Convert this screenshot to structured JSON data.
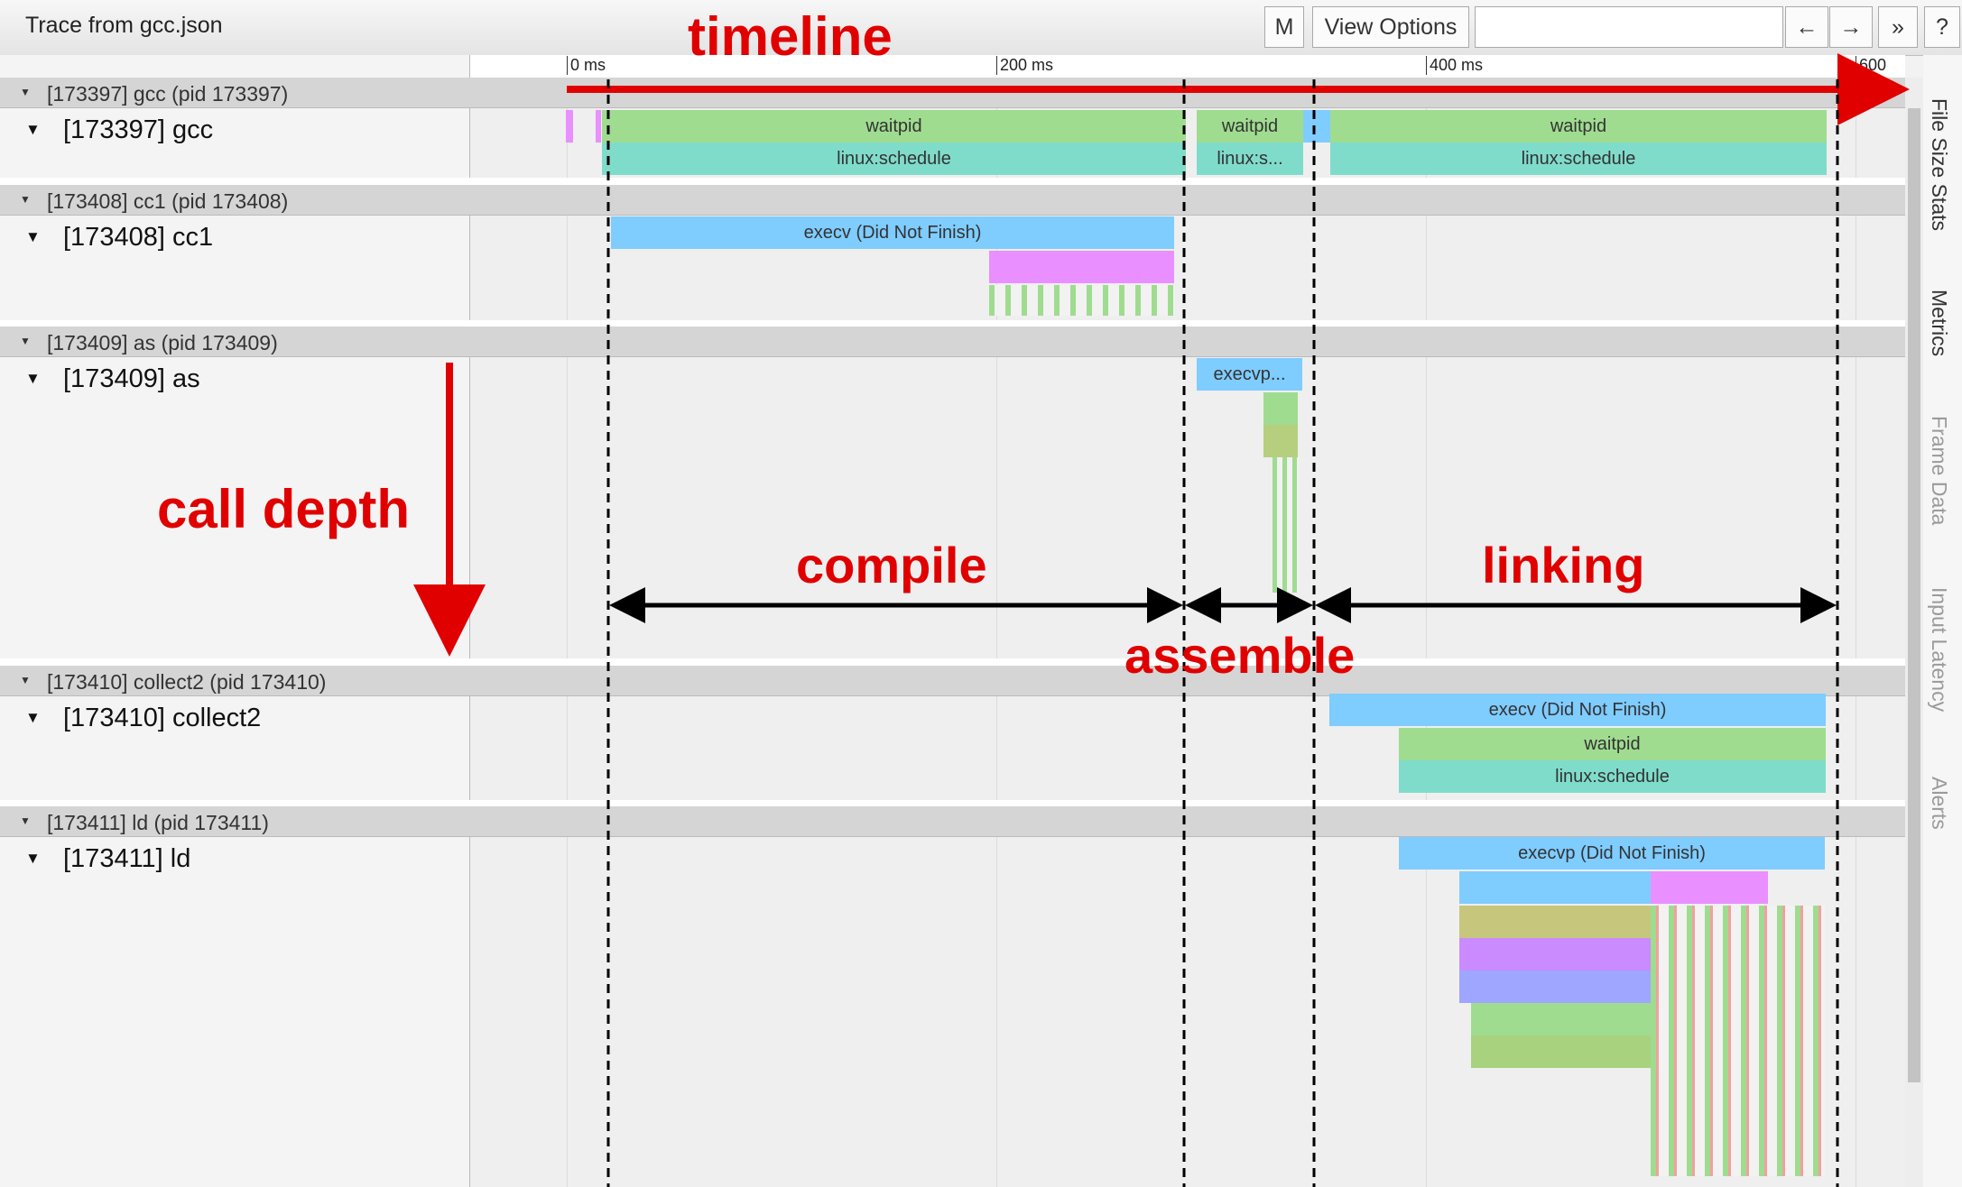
{
  "window": {
    "title": "Trace from gcc.json"
  },
  "toolbar": {
    "m_label": "M",
    "view_options_label": "View Options",
    "search_value": "",
    "prev_label": "←",
    "next_label": "→",
    "more_label": "»",
    "help_label": "?"
  },
  "ruler": {
    "ticks": [
      "0 ms",
      "200 ms",
      "400 ms",
      "600 ms"
    ]
  },
  "processes": [
    {
      "header": "[173397] gcc (pid 173397)",
      "thread": "[173397] gcc"
    },
    {
      "header": "[173408] cc1 (pid 173408)",
      "thread": "[173408] cc1"
    },
    {
      "header": "[173409] as (pid 173409)",
      "thread": "[173409] as"
    },
    {
      "header": "[173410] collect2 (pid 173410)",
      "thread": "[173410] collect2"
    },
    {
      "header": "[173411] ld (pid 173411)",
      "thread": "[173411] ld"
    }
  ],
  "slices": {
    "gcc_waitpid_1": "waitpid",
    "gcc_sched_1": "linux:schedule",
    "gcc_waitpid_2": "waitpid",
    "gcc_sched_2": "linux:s...",
    "gcc_waitpid_3": "waitpid",
    "gcc_sched_3": "linux:schedule",
    "cc1_execv": "execv (Did Not Finish)",
    "as_execvp": "execvp...",
    "collect2_execv": "execv (Did Not Finish)",
    "collect2_waitpid": "waitpid",
    "collect2_sched": "linux:schedule",
    "ld_execvp": "execvp (Did Not Finish)"
  },
  "side_tabs": [
    "File Size Stats",
    "Metrics",
    "Frame Data",
    "Input Latency",
    "Alerts"
  ],
  "annotations": {
    "timeline": "timeline",
    "call_depth": "call depth",
    "compile": "compile",
    "assemble": "assemble",
    "linking": "linking"
  },
  "colors": {
    "blue": "#7fccff",
    "green": "#9fdc8f",
    "teal": "#7fdccb",
    "pink": "#e98fff",
    "annotation_red": "#e00000"
  }
}
